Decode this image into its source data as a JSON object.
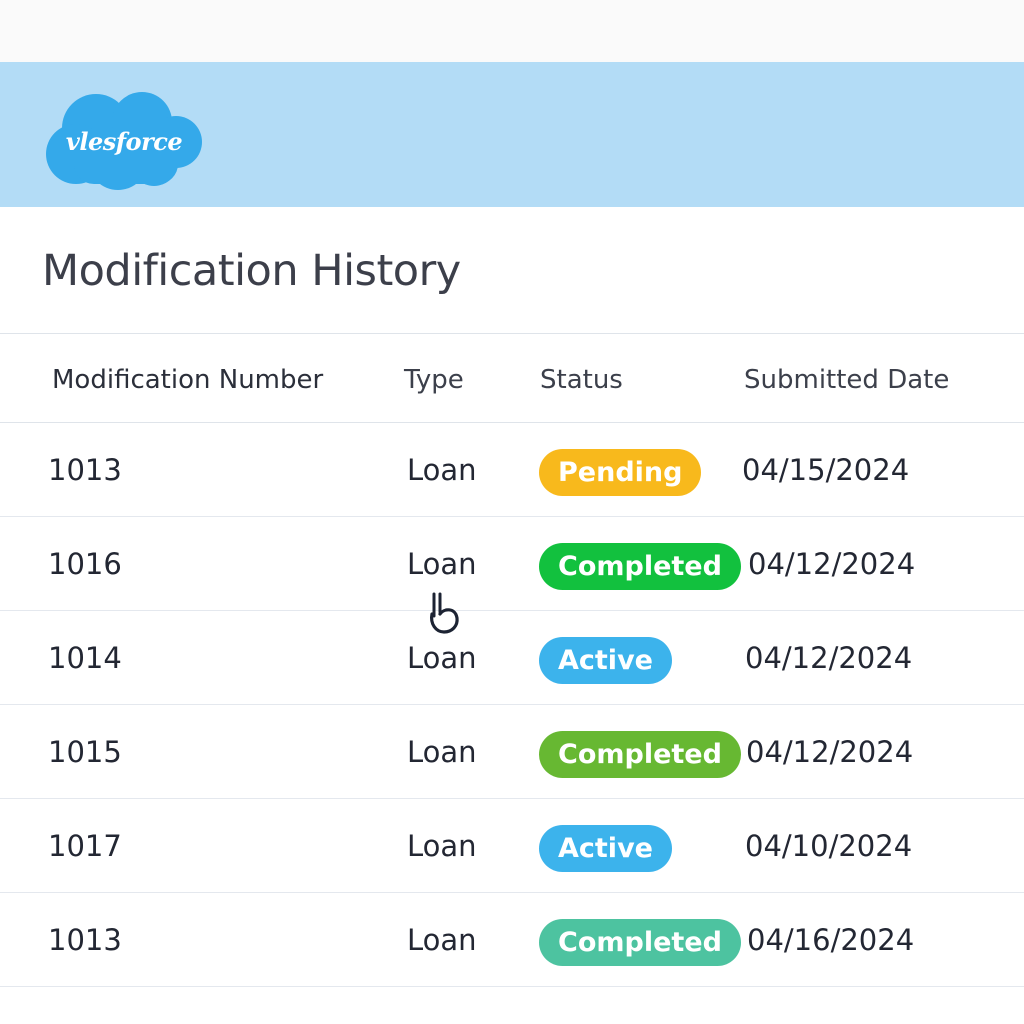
{
  "app": {
    "logo_text": "vlesforce",
    "brand_color": "#34a9ea",
    "header_color": "#b3dcf6"
  },
  "page": {
    "title": "Modification History"
  },
  "table": {
    "columns": [
      "Modification Number",
      "Type",
      "Status",
      "Submitted Date"
    ],
    "rows": [
      {
        "number": "1013",
        "type": "Loan",
        "status": "Pending",
        "status_color": "#f8b91c",
        "date": "04/15/2024"
      },
      {
        "number": "1016",
        "type": "Loan",
        "status": "Completed",
        "status_color": "#12c13e",
        "date": "04/12/2024"
      },
      {
        "number": "1014",
        "type": "Loan",
        "status": "Active",
        "status_color": "#3cb3ec",
        "date": "04/12/2024"
      },
      {
        "number": "1015",
        "type": "Loan",
        "status": "Completed",
        "status_color": "#67b832",
        "date": "04/12/2024"
      },
      {
        "number": "1017",
        "type": "Loan",
        "status": "Active",
        "status_color": "#3cb3ec",
        "date": "04/10/2024"
      },
      {
        "number": "1013",
        "type": "Loan",
        "status": "Completed",
        "status_color": "#4dc3a0",
        "date": "04/16/2024"
      }
    ]
  },
  "icons": {
    "cursor": "hand-pointer-icon"
  }
}
